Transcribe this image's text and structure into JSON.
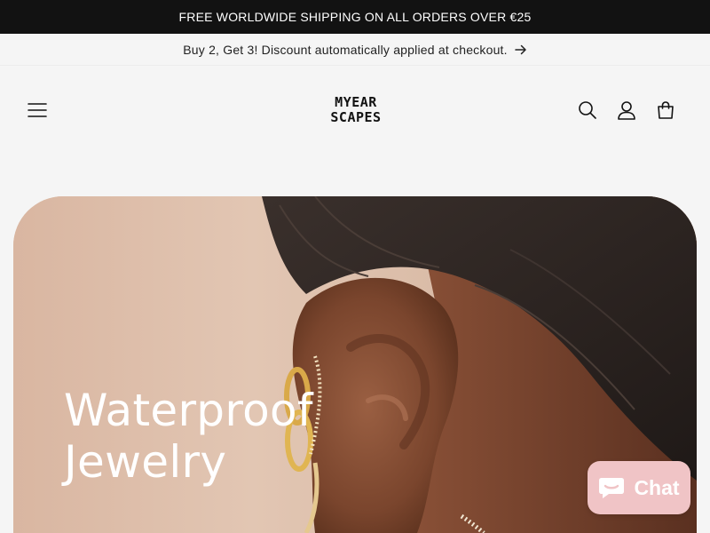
{
  "announcement": {
    "text": "FREE WORLDWIDE SHIPPING ON ALL ORDERS OVER  €25"
  },
  "promo": {
    "text": "Buy 2, Get 3! Discount automatically applied at checkout.",
    "arrow_icon": "arrow-right-icon"
  },
  "header": {
    "logo_line1": "MYEAR",
    "logo_line2": "SCAPES",
    "icons": [
      "menu-icon",
      "search-icon",
      "account-icon",
      "cart-icon"
    ]
  },
  "hero": {
    "title_line1": "Waterproof",
    "title_line2": "Jewelry"
  },
  "chat": {
    "label": "Chat",
    "icon": "chat-bubble-icon"
  },
  "colors": {
    "announcement_bg": "#121212",
    "page_bg": "#f5f5f5",
    "hero_bg": "#d9bca7",
    "chat_bg": "#f0c4c6"
  }
}
